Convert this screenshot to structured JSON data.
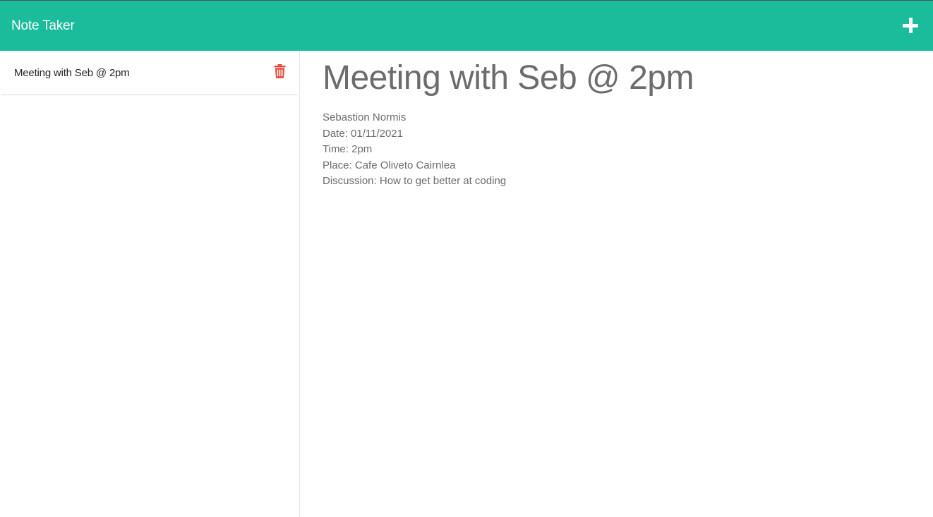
{
  "header": {
    "brand": "Note Taker",
    "new_note_icon": "plus-icon",
    "color": "#1abc9c"
  },
  "sidebar": {
    "notes": [
      {
        "title": "Meeting with Seb @ 2pm",
        "delete_icon": "trash-icon",
        "delete_color": "#dc3545"
      }
    ]
  },
  "main": {
    "title": "Meeting with Seb @ 2pm",
    "lines": [
      "Sebastion Normis",
      "Date: 01/11/2021",
      "Time: 2pm",
      "Place: Cafe Oliveto Cairnlea",
      "Discussion: How to get better at coding"
    ]
  }
}
